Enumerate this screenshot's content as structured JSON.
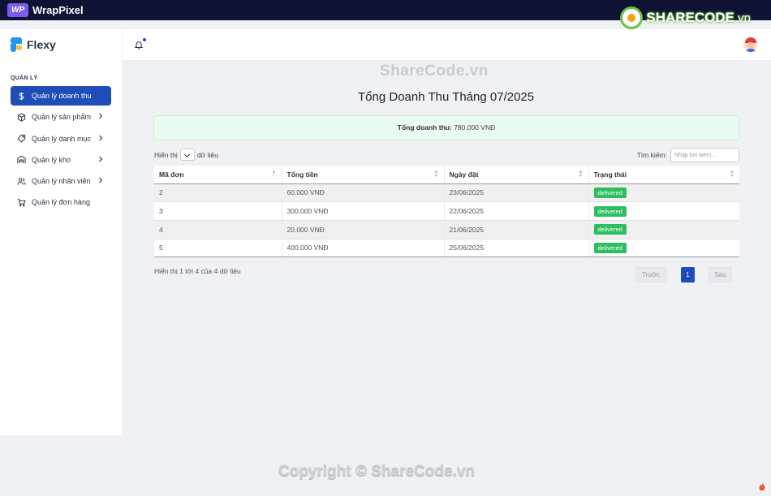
{
  "topbar": {
    "wrappixel_mark": "WP",
    "wrappixel_label": "WrapPixel",
    "sharecode_name": "SHARECODE",
    "sharecode_domain": ".vn"
  },
  "sidebar": {
    "brand": "Flexy",
    "section": "QUẢN LÝ",
    "items": [
      {
        "label": "Quản lý doanh thu",
        "icon": "dollar-icon",
        "active": true,
        "chevron": false
      },
      {
        "label": "Quản lý sản phẩm",
        "icon": "box-icon",
        "active": false,
        "chevron": true
      },
      {
        "label": "Quản lý danh mục",
        "icon": "tag-icon",
        "active": false,
        "chevron": true
      },
      {
        "label": "Quản lý kho",
        "icon": "warehouse-icon",
        "active": false,
        "chevron": true
      },
      {
        "label": "Quản lý nhân viên",
        "icon": "users-icon",
        "active": false,
        "chevron": true
      },
      {
        "label": "Quản lý đơn hàng",
        "icon": "cart-icon",
        "active": false,
        "chevron": false
      }
    ]
  },
  "watermark": {
    "top": "ShareCode.vn",
    "bottom": "Copyright © ShareCode.vn"
  },
  "main": {
    "title": "Tổng Doanh Thu Tháng 07/2025",
    "total_label": "Tổng doanh thu:",
    "total_value": "780.000 VNĐ",
    "show_prefix": "Hiển thị",
    "show_suffix": "dữ liệu",
    "search_label": "Tìm kiếm:",
    "search_placeholder": "Nhập tìm kiếm...",
    "columns": [
      "Mã đơn",
      "Tổng tiền",
      "Ngày đặt",
      "Trạng thái"
    ],
    "rows": [
      {
        "id": "2",
        "total": "60.000 VNĐ",
        "date": "23/06/2025",
        "status": "delivered"
      },
      {
        "id": "3",
        "total": "300.000 VNĐ",
        "date": "22/06/2025",
        "status": "delivered"
      },
      {
        "id": "4",
        "total": "20.000 VNĐ",
        "date": "21/06/2025",
        "status": "delivered"
      },
      {
        "id": "5",
        "total": "400.000 VNĐ",
        "date": "25/06/2025",
        "status": "delivered"
      }
    ],
    "info": "Hiển thị 1 tới 4 của 4 dữ liệu",
    "pager": {
      "prev": "Trước",
      "current": "1",
      "next": "Sau"
    }
  },
  "colors": {
    "accent": "#1e4db7",
    "status_green": "#2dbe60",
    "topbar": "#0e1233"
  }
}
